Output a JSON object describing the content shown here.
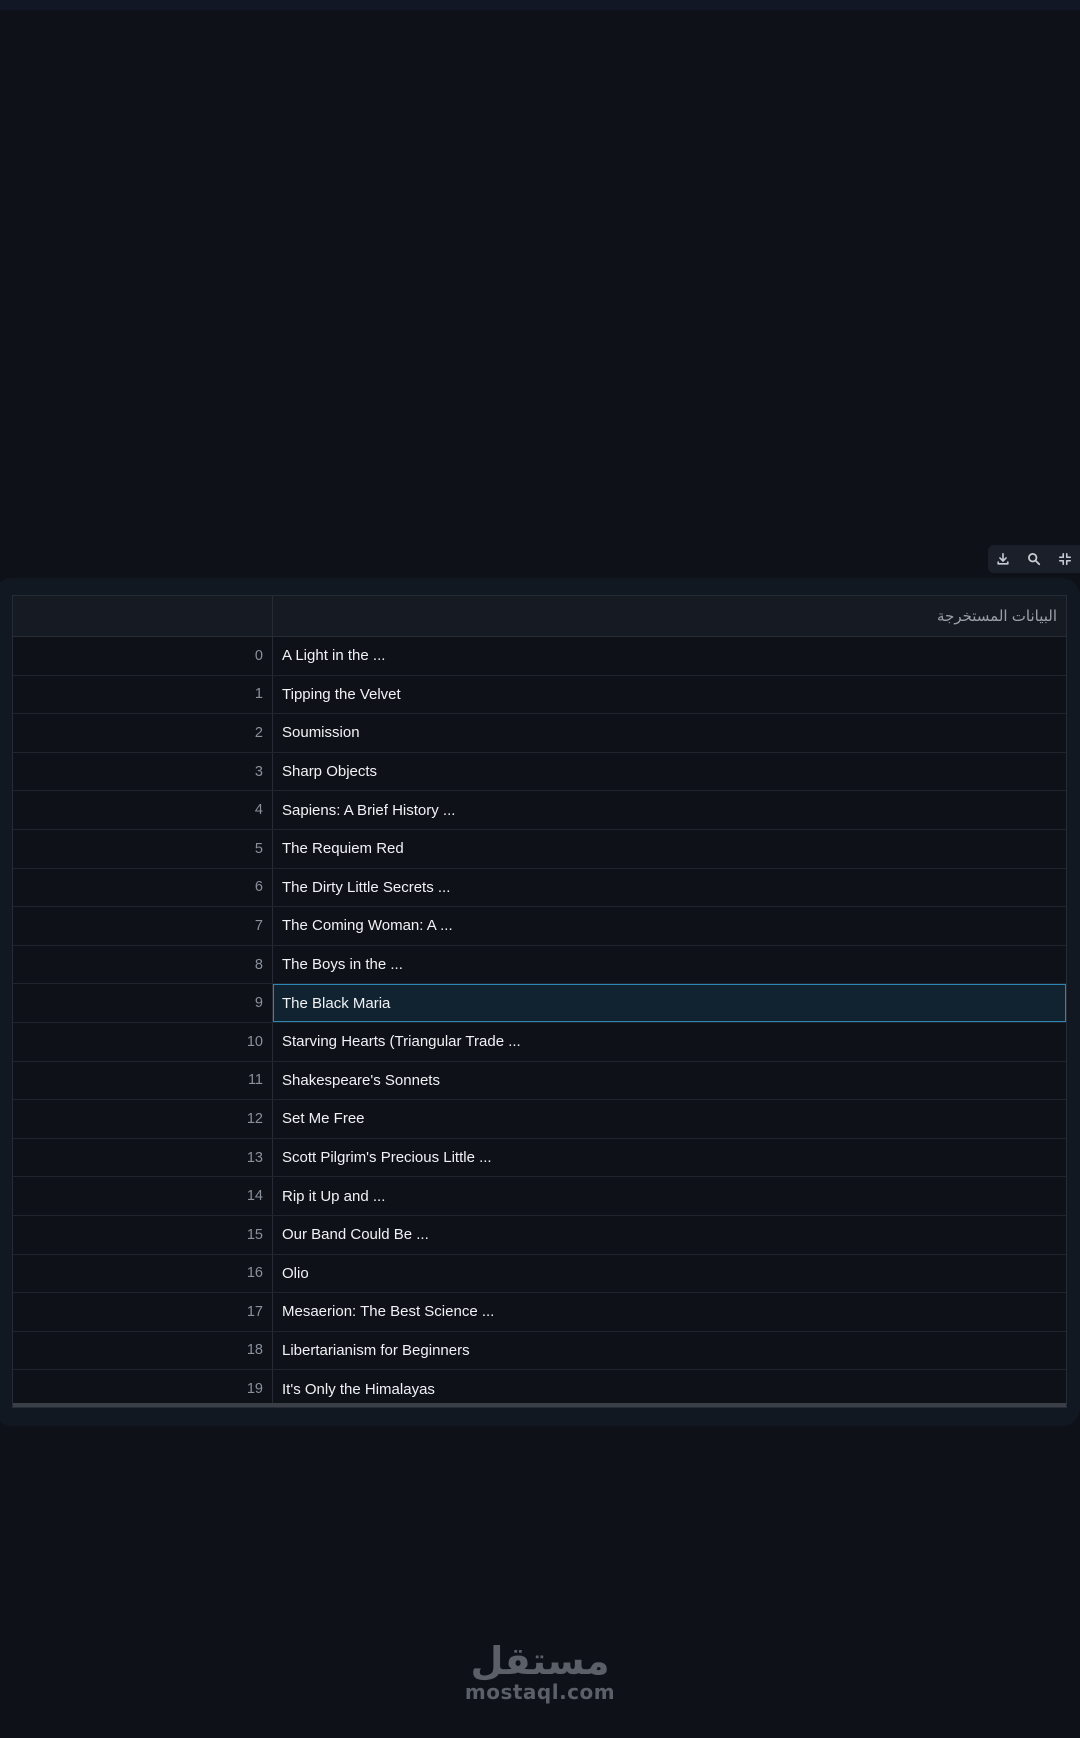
{
  "toolbar": {
    "icons": [
      "download-icon",
      "search-icon",
      "fullscreen-icon"
    ]
  },
  "table": {
    "column_header": "البيانات المستخرجة",
    "selected_index": 9,
    "rows": [
      {
        "index": "0",
        "value": "A Light in the ..."
      },
      {
        "index": "1",
        "value": "Tipping the Velvet"
      },
      {
        "index": "2",
        "value": "Soumission"
      },
      {
        "index": "3",
        "value": "Sharp Objects"
      },
      {
        "index": "4",
        "value": "Sapiens: A Brief History ..."
      },
      {
        "index": "5",
        "value": "The Requiem Red"
      },
      {
        "index": "6",
        "value": "The Dirty Little Secrets ..."
      },
      {
        "index": "7",
        "value": "The Coming Woman: A ..."
      },
      {
        "index": "8",
        "value": "The Boys in the ..."
      },
      {
        "index": "9",
        "value": "The Black Maria"
      },
      {
        "index": "10",
        "value": "Starving Hearts (Triangular Trade ..."
      },
      {
        "index": "11",
        "value": "Shakespeare's Sonnets"
      },
      {
        "index": "12",
        "value": "Set Me Free"
      },
      {
        "index": "13",
        "value": "Scott Pilgrim's Precious Little ..."
      },
      {
        "index": "14",
        "value": "Rip it Up and ..."
      },
      {
        "index": "15",
        "value": "Our Band Could Be ..."
      },
      {
        "index": "16",
        "value": "Olio"
      },
      {
        "index": "17",
        "value": "Mesaerion: The Best Science ..."
      },
      {
        "index": "18",
        "value": "Libertarianism for Beginners"
      },
      {
        "index": "19",
        "value": "It's Only the Himalayas"
      }
    ]
  },
  "watermark": {
    "logo_text": "مستقل",
    "text": "mostaql.com"
  },
  "colors": {
    "background": "#0e1117",
    "selection_border": "#2b86b4",
    "selection_fill": "#112330",
    "text": "#f0f2f6"
  }
}
